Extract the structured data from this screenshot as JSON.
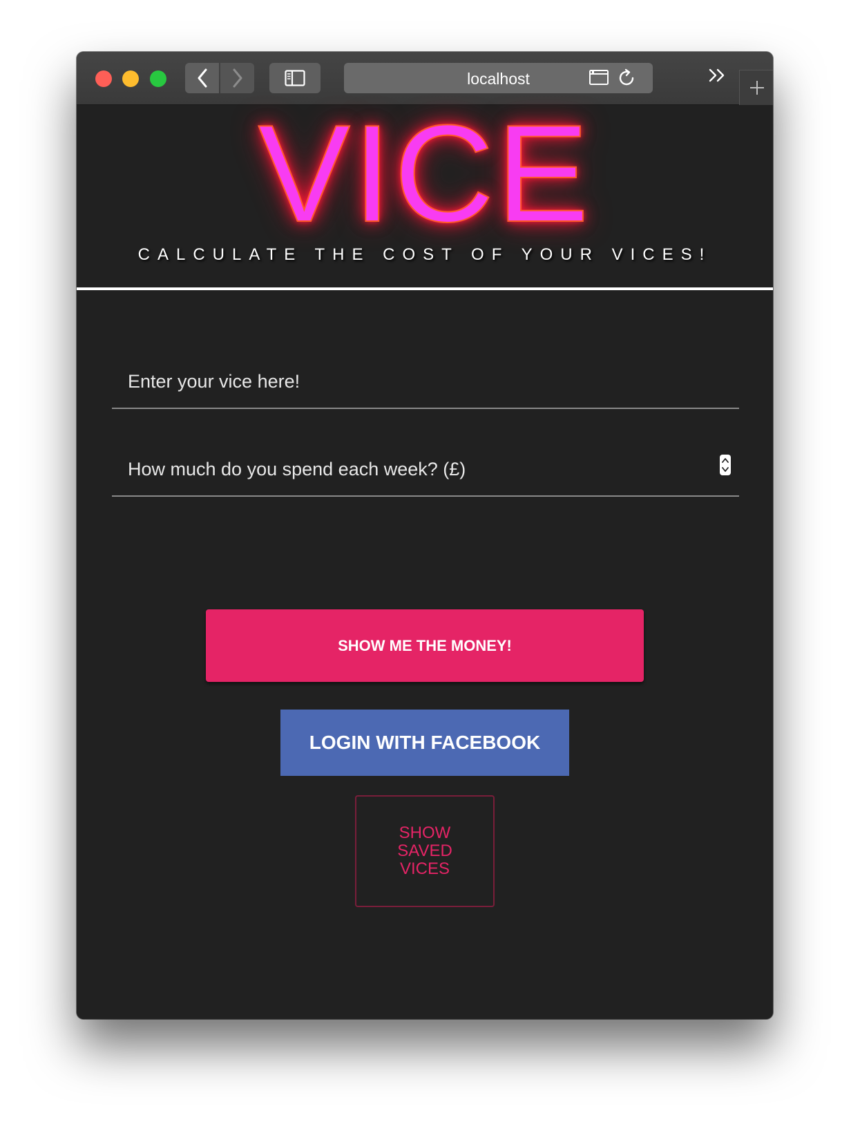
{
  "browser": {
    "address": "localhost",
    "icons": {
      "back": "chevron-left-icon",
      "forward": "chevron-right-icon",
      "sidebar": "sidebar-icon",
      "tabs": "tab-overview-icon",
      "reload": "reload-icon",
      "more": "double-chevron-right-icon",
      "new_tab": "plus-icon"
    }
  },
  "header": {
    "logo": "VICE",
    "tagline": "CALCULATE THE COST OF YOUR VICES!"
  },
  "form": {
    "vice_placeholder": "Enter your vice here!",
    "spend_placeholder": "How much do you spend each week? (£)"
  },
  "buttons": {
    "money": "SHOW ME THE MONEY!",
    "facebook": "LOGIN WITH FACEBOOK",
    "saved": "SHOW SAVED VICES"
  },
  "colors": {
    "background": "#212121",
    "logo_fill": "#f83cf2",
    "logo_glow": "#ff1a3a",
    "accent": "#e52466",
    "facebook": "#4c69b3"
  }
}
